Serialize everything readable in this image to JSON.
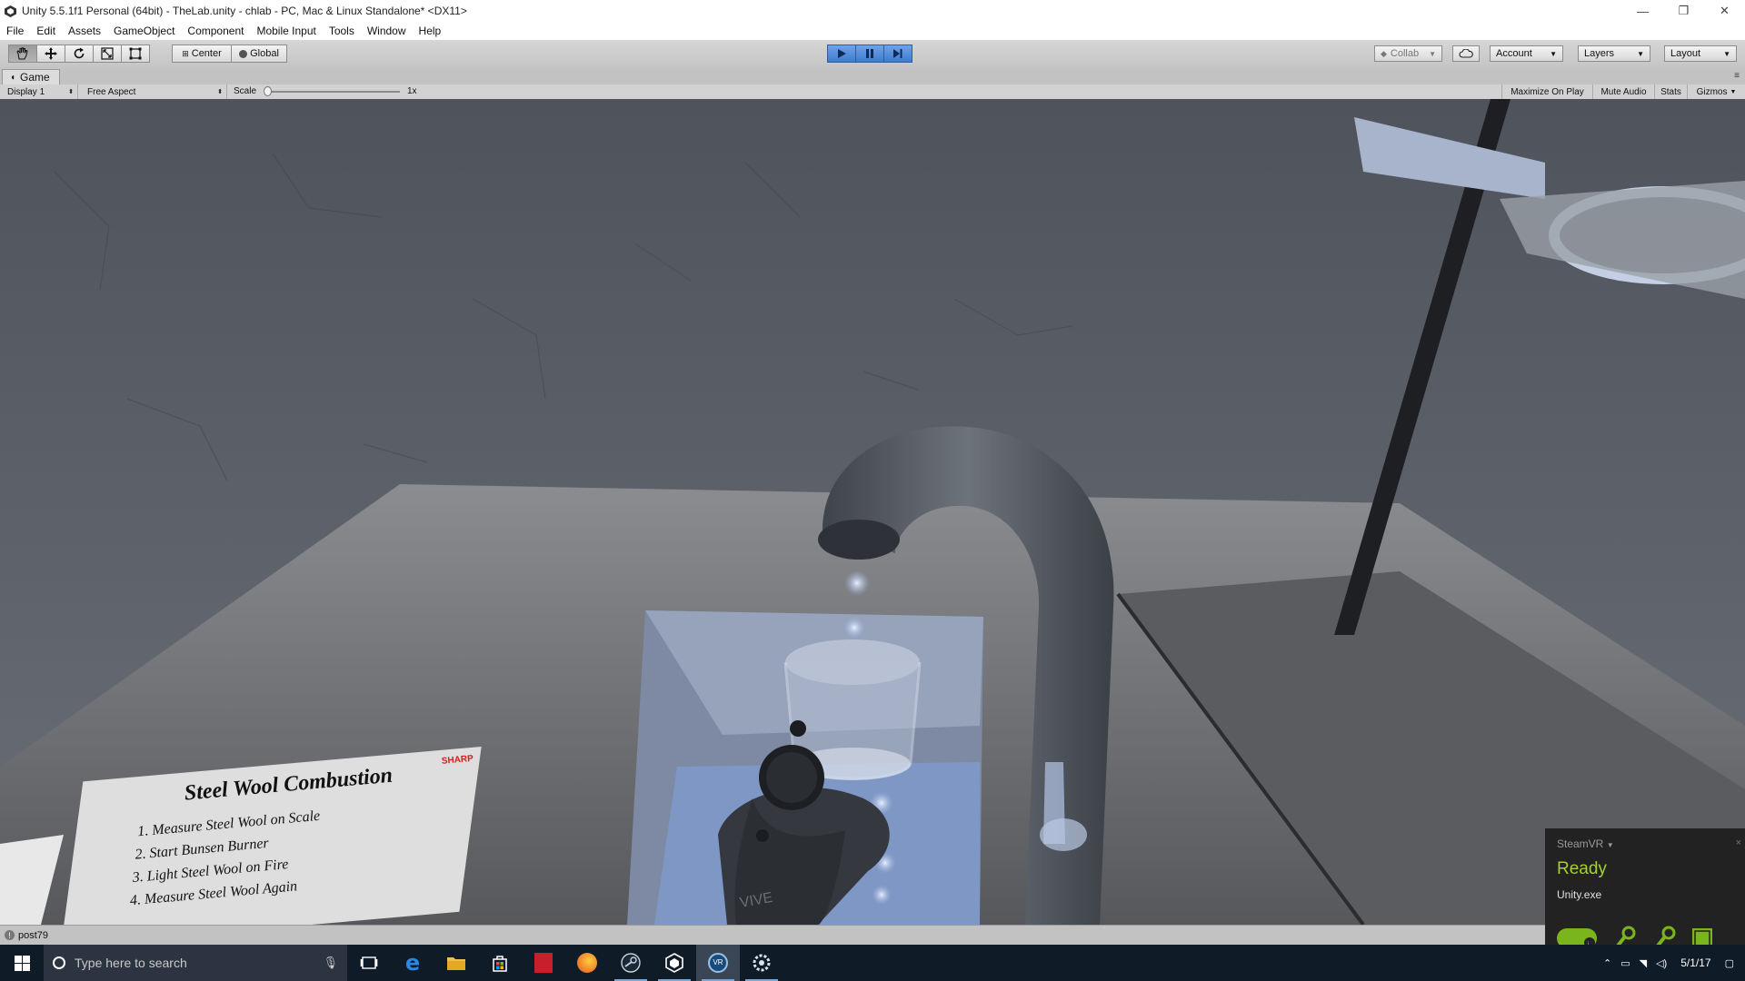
{
  "window": {
    "title": "Unity 5.5.1f1 Personal (64bit) - TheLab.unity - chlab - PC, Mac & Linux Standalone* <DX11>",
    "minimize_glyph": "—",
    "restore_glyph": "❐",
    "close_glyph": "✕"
  },
  "menu": [
    "File",
    "Edit",
    "Assets",
    "GameObject",
    "Component",
    "Mobile Input",
    "Tools",
    "Window",
    "Help"
  ],
  "toolbar": {
    "pivot_label": "Center",
    "space_label": "Global",
    "collab_label": "Collab",
    "account_label": "Account",
    "layers_label": "Layers",
    "layout_label": "Layout",
    "play_state": "playing"
  },
  "game_view": {
    "tab_label": "Game",
    "display_label": "Display 1",
    "aspect_label": "Free Aspect",
    "scale_label": "Scale",
    "scale_value": "1x",
    "maximize_label": "Maximize On Play",
    "mute_label": "Mute Audio",
    "stats_label": "Stats",
    "gizmos_label": "Gizmos"
  },
  "scene": {
    "sign_title": "Steel Wool Combustion",
    "sign_stamp": "SHARP",
    "sign_steps": [
      "1. Measure Steel Wool on Scale",
      "2. Start Bunsen Burner",
      "3. Light Steel Wool on Fire",
      "4. Measure Steel Wool Again"
    ],
    "controller_brand": "VIVE"
  },
  "status": {
    "message": "post79"
  },
  "steamvr": {
    "header": "SteamVR",
    "status": "Ready",
    "app": "Unity.exe",
    "status_color": "#a7d129"
  },
  "taskbar": {
    "search_placeholder": "Type here to search",
    "date": "5/1/17"
  }
}
